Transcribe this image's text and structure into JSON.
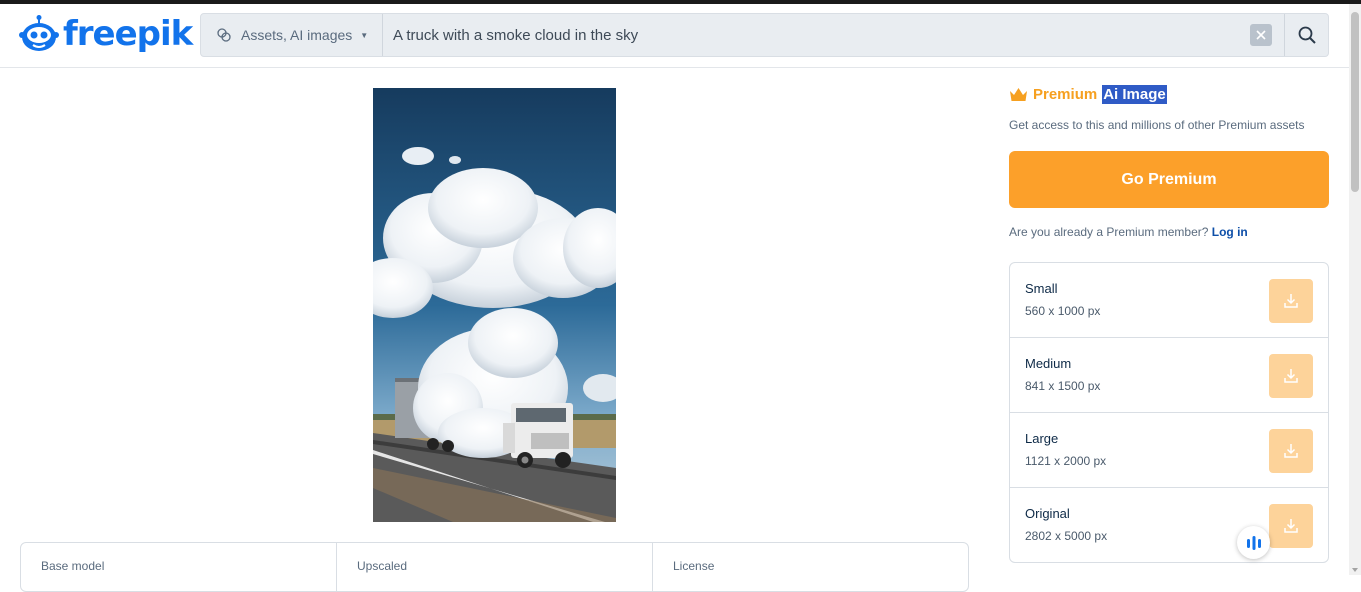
{
  "brand": {
    "name": "freepik",
    "color": "#1273eb"
  },
  "search": {
    "category": "Assets, AI images",
    "query": "A truck with a smoke cloud in the sky",
    "icons": {
      "category": "ai-sparkle-icon",
      "clear": "close-icon",
      "submit": "search-icon"
    }
  },
  "image": {
    "alt": "A truck with a smoke cloud in the sky"
  },
  "info": {
    "cells": [
      "Base model",
      "Upscaled",
      "License"
    ]
  },
  "premium": {
    "label": "Premium",
    "type": "Ai Image",
    "subtitle": "Get access to this and millions of other Premium assets",
    "button": "Go Premium",
    "member_question": "Are you already a Premium member?",
    "login": "Log in",
    "accent": "#fca02a"
  },
  "sizes": [
    {
      "name": "Small",
      "dims": "560 x 1000 px"
    },
    {
      "name": "Medium",
      "dims": "841 x 1500 px"
    },
    {
      "name": "Large",
      "dims": "1121 x 2000 px"
    },
    {
      "name": "Original",
      "dims": "2802 x 5000 px"
    }
  ]
}
